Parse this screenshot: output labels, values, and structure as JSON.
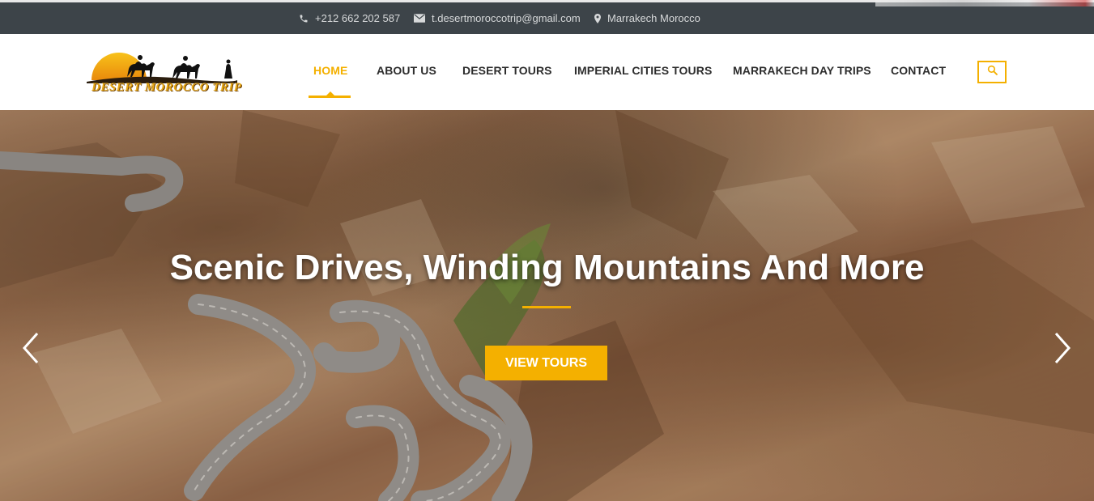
{
  "topbar": {
    "phone": "+212 662 202 587",
    "email": "t.desertmoroccotrip@gmail.com",
    "location": "Marrakech Morocco",
    "icons": [
      "phone-icon",
      "envelope-icon",
      "map-marker-icon"
    ]
  },
  "brand": {
    "logo_text": "DESERT MOROCCO TRIP"
  },
  "nav": {
    "items": [
      {
        "label": "HOME",
        "active": true
      },
      {
        "label": "ABOUT US",
        "active": false
      },
      {
        "label": "DESERT TOURS",
        "active": false
      },
      {
        "label": "IMPERIAL CITIES TOURS",
        "active": false
      },
      {
        "label": "MARRAKECH DAY TRIPS",
        "active": false
      },
      {
        "label": "CONTACT",
        "active": false
      }
    ],
    "search_icon": "search-icon"
  },
  "hero": {
    "title": "Scenic Drives, Winding Mountains And More",
    "button_label": "VIEW TOURS",
    "prev_icon": "chevron-left-icon",
    "next_icon": "chevron-right-icon"
  },
  "colors": {
    "accent": "#f4b000",
    "topbar_bg": "#3d4449",
    "nav_text": "#2d2d2d"
  }
}
